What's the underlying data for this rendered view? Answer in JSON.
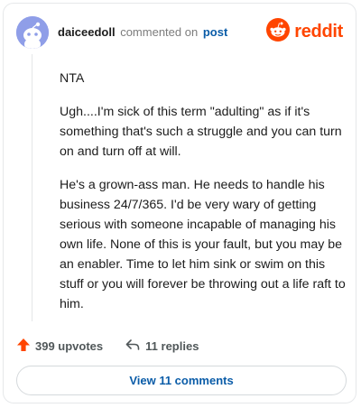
{
  "comment": {
    "username": "daiceedoll",
    "action_text": "commented on",
    "post_link": "post",
    "paragraphs": [
      "NTA",
      "Ugh....I'm sick of this term \"adulting\" as if it's something that's such a struggle and you can turn on and turn off at will.",
      "He's a grown-ass man. He needs to handle his business 24/7/365. I'd be very wary of getting serious with someone incapable of managing his own life. None of this is your fault, but you may be an enabler. Time to let him sink or swim on this stuff or you will forever be throwing out a life raft to him."
    ]
  },
  "brand": {
    "wordmark": "reddit",
    "color": "#ff4500"
  },
  "footer": {
    "upvotes": "399 upvotes",
    "replies": "11 replies",
    "view_comments": "View 11 comments"
  },
  "colors": {
    "link": "#0a5ca8",
    "upvote": "#ff4500",
    "avatar_bg": "#8f9ee8"
  },
  "icons": {
    "avatar": "snoo-avatar-icon",
    "logo": "reddit-logo-icon",
    "upvote": "upvote-arrow-icon",
    "reply": "reply-arrow-icon"
  }
}
